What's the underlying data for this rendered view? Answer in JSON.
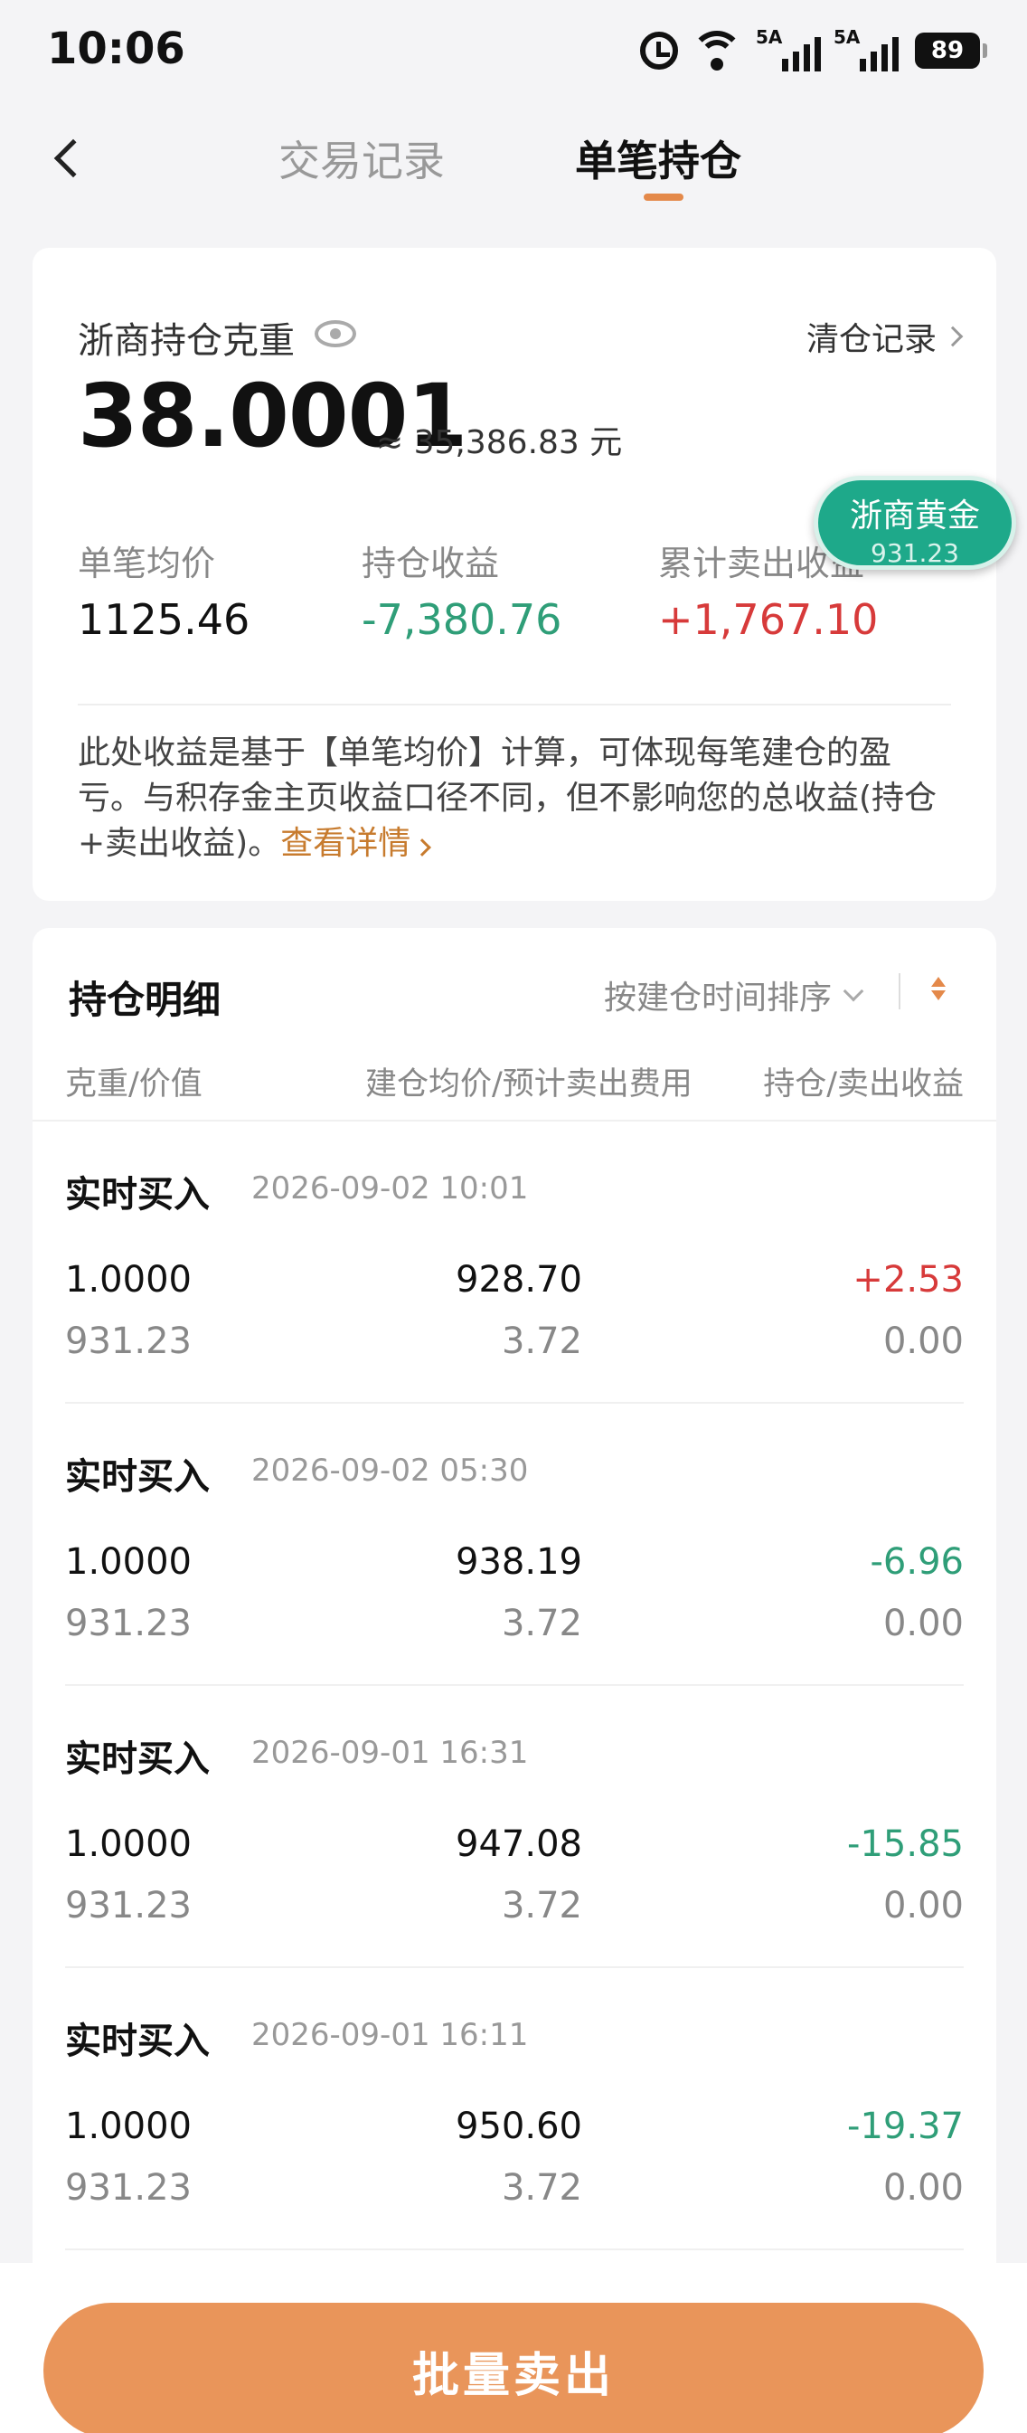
{
  "status_bar": {
    "time": "10:06",
    "network_1": "5A",
    "network_2": "5A",
    "wifi_tag": "6",
    "battery": "89"
  },
  "nav": {
    "tabs": [
      {
        "label": "交易记录",
        "active": false
      },
      {
        "label": "单笔持仓",
        "active": true
      }
    ],
    "back_icon": "chevron-left-icon"
  },
  "summary": {
    "title": "浙商持仓克重",
    "clear_records": "清仓记录",
    "weight": "38.0001",
    "approx_value": "≈ 35,386.83 元",
    "metrics": [
      {
        "label": "单笔均价",
        "value": "1125.46"
      },
      {
        "label": "持仓收益",
        "value": "-7,380.76"
      },
      {
        "label": "累计卖出收益",
        "value": "+1,767.10"
      }
    ],
    "note": "此处收益是基于【单笔均价】计算，可体现每笔建仓的盈亏。与积存金主页收益口径不同，但不影响您的总收益(持仓+卖出收益)。",
    "note_link": "查看详情"
  },
  "floating_badge": {
    "name": "浙商黄金",
    "price": "931.23"
  },
  "detail": {
    "title": "持仓明细",
    "sort_label": "按建仓时间排序",
    "columns": [
      "克重/价值",
      "建仓均价/预计卖出费用",
      "持仓/卖出收益"
    ],
    "rows": [
      {
        "type": "实时买入",
        "time": "2026-09-02 10:01",
        "weight": "1.0000",
        "value": "931.23",
        "avg_cost": "928.70",
        "fee": "3.72",
        "pnl": "+2.53",
        "sold_pnl": "0.00"
      },
      {
        "type": "实时买入",
        "time": "2026-09-02 05:30",
        "weight": "1.0000",
        "value": "931.23",
        "avg_cost": "938.19",
        "fee": "3.72",
        "pnl": "-6.96",
        "sold_pnl": "0.00"
      },
      {
        "type": "实时买入",
        "time": "2026-09-01 16:31",
        "weight": "1.0000",
        "value": "931.23",
        "avg_cost": "947.08",
        "fee": "3.72",
        "pnl": "-15.85",
        "sold_pnl": "0.00"
      },
      {
        "type": "实时买入",
        "time": "2026-09-01 16:11",
        "weight": "1.0000",
        "value": "931.23",
        "avg_cost": "950.60",
        "fee": "3.72",
        "pnl": "-19.37",
        "sold_pnl": "0.00"
      }
    ]
  },
  "bottom": {
    "sell_button": "批量卖出"
  },
  "colors": {
    "accent": "#e4894a",
    "button": "#e9955a",
    "gain": "#d73a3a",
    "loss": "#2f9e78",
    "badge": "#1ea98a"
  }
}
